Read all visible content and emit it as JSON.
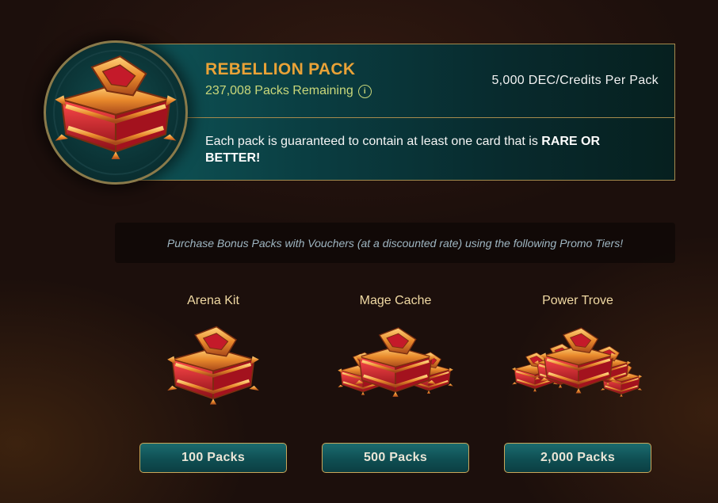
{
  "pack": {
    "title": "REBELLION PACK",
    "remaining": "237,008 Packs Remaining",
    "price": "5,000 DEC/Credits Per Pack",
    "guarantee_text": "Each pack is guaranteed to contain at least one card that is ",
    "guarantee_emphasis": "RARE OR BETTER!",
    "info_icon": "info-icon"
  },
  "promo": {
    "text": "Purchase Bonus Packs with Vouchers (at a discounted rate) using the following Promo Tiers!"
  },
  "tiers": [
    {
      "name": "Arena Kit",
      "button": "100 Packs"
    },
    {
      "name": "Mage Cache",
      "button": "500 Packs"
    },
    {
      "name": "Power Trove",
      "button": "2,000 Packs"
    }
  ],
  "colors": {
    "accent_gold": "#e9a237",
    "panel_teal": "#0a3d41",
    "border_gold": "#a58a4d",
    "chest_red": "#c41a2a"
  }
}
